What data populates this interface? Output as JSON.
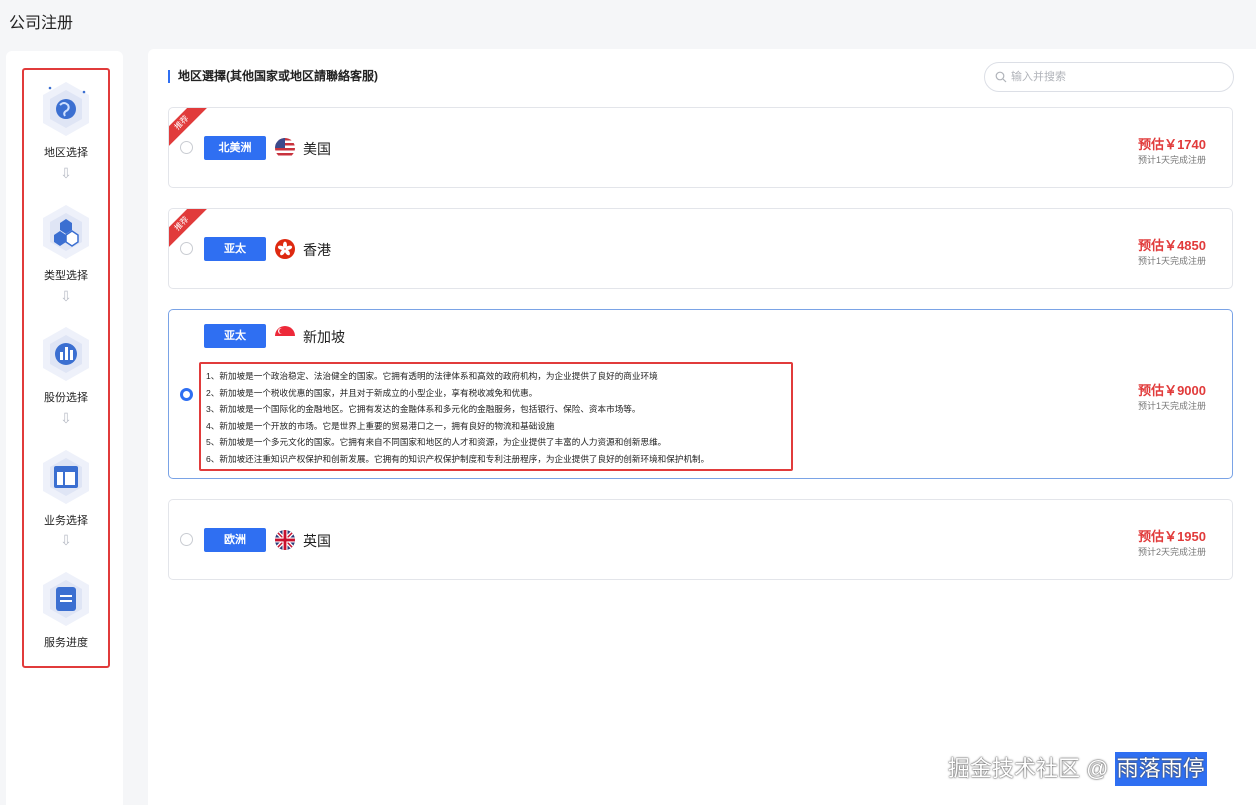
{
  "page": {
    "title": "公司注册"
  },
  "sidebar": {
    "steps": [
      {
        "label": "地区选择",
        "icon": "globe-icon"
      },
      {
        "label": "类型选择",
        "icon": "cubes-icon"
      },
      {
        "label": "股份选择",
        "icon": "bar-chart-icon"
      },
      {
        "label": "业务选择",
        "icon": "layout-icon"
      },
      {
        "label": "服务进度",
        "icon": "document-icon"
      }
    ],
    "arrow": "⇩"
  },
  "main": {
    "heading": "地区選擇(其他国家或地区請聯絡客服)",
    "search": {
      "placeholder": "输入并搜索"
    },
    "cards": [
      {
        "ribbon": "推荐",
        "region": "北美洲",
        "country": "美国",
        "price": "预估￥1740",
        "eta": "预计1天完成注册",
        "selected": false
      },
      {
        "ribbon": "推荐",
        "region": "亚太",
        "country": "香港",
        "price": "预估￥4850",
        "eta": "预计1天完成注册",
        "selected": false
      },
      {
        "region": "亚太",
        "country": "新加坡",
        "price": "预估￥9000",
        "eta": "预计1天完成注册",
        "selected": true,
        "description": [
          "1、新加坡是一个政治稳定、法治健全的国家。它拥有透明的法律体系和高效的政府机构，为企业提供了良好的商业环境",
          "2、新加坡是一个税收优惠的国家，并且对于新成立的小型企业，享有税收减免和优惠。",
          "3、新加坡是一个国际化的金融地区。它拥有发达的金融体系和多元化的金融服务，包括银行、保险、资本市场等。",
          "4、新加坡是一个开放的市场。它是世界上重要的贸易港口之一，拥有良好的物流和基础设施",
          "5、新加坡是一个多元文化的国家。它拥有来自不同国家和地区的人才和资源，为企业提供了丰富的人力资源和创新思维。",
          "6、新加坡还注重知识产权保护和创新发展。它拥有的知识产权保护制度和专利注册程序，为企业提供了良好的创新环境和保护机制。"
        ]
      },
      {
        "region": "欧洲",
        "country": "英国",
        "price": "预估￥1950",
        "eta": "预计2天完成注册",
        "selected": false
      }
    ]
  },
  "watermark": {
    "prefix": "掘金技术社区 @ ",
    "author": "雨落雨停"
  },
  "colors": {
    "accent": "#2f6ff2",
    "price": "#e13b3b",
    "highlight_border": "#e13b3b"
  }
}
